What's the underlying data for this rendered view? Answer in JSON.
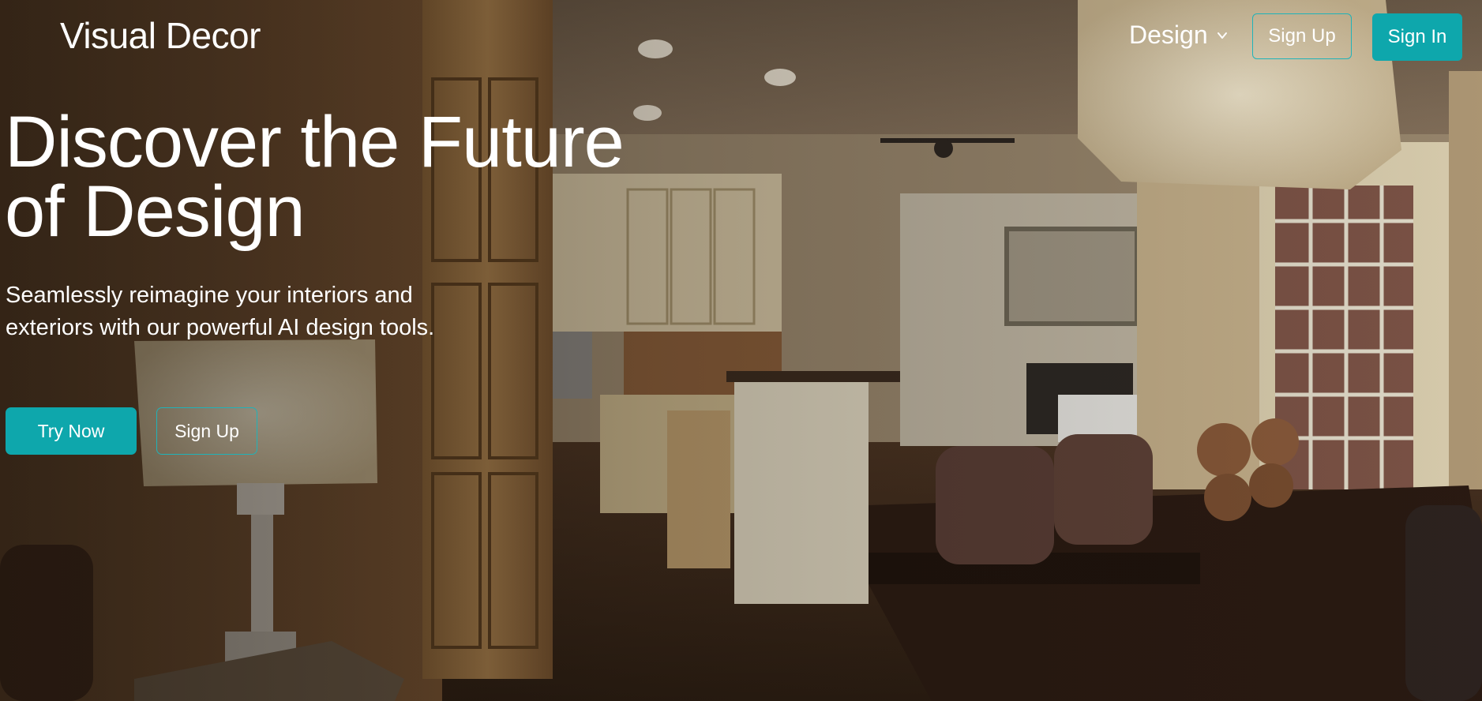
{
  "header": {
    "brand": "Visual Decor",
    "nav_design_label": "Design",
    "sign_up_label": "Sign Up",
    "sign_in_label": "Sign In"
  },
  "hero": {
    "title_line1": "Discover the Future",
    "title_line2": "of Design",
    "subtitle": "Seamlessly reimagine your interiors and exteriors with our powerful AI design tools.",
    "try_now_label": "Try Now",
    "sign_up_label": "Sign Up"
  },
  "colors": {
    "accent": "#0ea7ac",
    "accent_border": "#1fb3b9",
    "text": "#ffffff"
  },
  "icons": {
    "nav_dropdown": "chevron-down-icon"
  }
}
